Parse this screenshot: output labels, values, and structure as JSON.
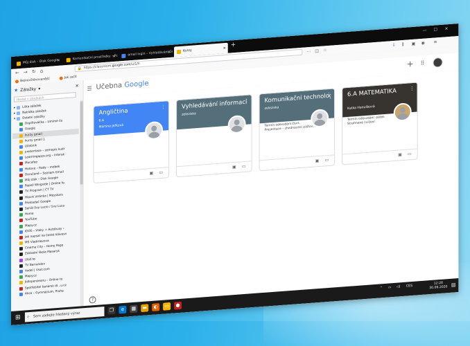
{
  "tabs": [
    {
      "label": "Můj disk – Disk Google",
      "color": "#f4b400",
      "active": false
    },
    {
      "label": "Komunikační prostředky – Po...",
      "color": "#f4b400",
      "active": false
    },
    {
      "label": "email login – Vyhledávání Goo...",
      "color": "#4285f4",
      "active": false
    },
    {
      "label": "Kurzy",
      "color": "#f4b400",
      "active": true
    }
  ],
  "nav": {
    "url_prefix": "https://classroom.",
    "url_domain": "google.com",
    "url_path": "/u/1/h"
  },
  "bookmarks_bar": [
    {
      "label": "Nejnavštěvovanější",
      "color": "#e8710a"
    },
    {
      "label": "Jak začít",
      "color": "#e8710a"
    }
  ],
  "sidebar": {
    "title": "Záložky",
    "search_placeholder": "Hledat v záložkách",
    "items": [
      {
        "label": "Lišta záložek",
        "level": "l1",
        "color": "#8ab4f8"
      },
      {
        "label": "Nabídka záložek",
        "level": "l1",
        "color": "#8ab4f8"
      },
      {
        "label": "Ostatní záložky",
        "level": "l1",
        "color": "#8ab4f8"
      },
      {
        "label": "Doplňováčka – Umíme če",
        "level": "l2",
        "color": "#34a853"
      },
      {
        "label": "Google",
        "level": "l2",
        "color": "#4285f4"
      },
      {
        "label": "kurzy gmail",
        "level": "l2",
        "color": "#f4b400",
        "selected": true
      },
      {
        "label": "kurzy gmail 1",
        "level": "l2",
        "color": "#f4b400"
      },
      {
        "label": "Učebnik",
        "level": "l2",
        "color": "#4285f4"
      },
      {
        "label": "prezentace – zemepis kudr",
        "level": "l2",
        "color": "#f4b400"
      },
      {
        "label": "Learningapps.org – interak",
        "level": "l2",
        "color": "#4285f4"
      },
      {
        "label": "Mocafee",
        "level": "l2",
        "color": "#c5221f"
      },
      {
        "label": "Hotove – Rady – mdbek",
        "level": "l2",
        "color": "#4285f4"
      },
      {
        "label": "Doručené – Seznam Email",
        "level": "l2",
        "color": "#c5221f"
      },
      {
        "label": "Můj disk – Disk Google",
        "level": "l2",
        "color": "#34a853"
      },
      {
        "label": "Papež Wingside | Online fo",
        "level": "l2",
        "color": "#4285f4"
      },
      {
        "label": "TV Program | ČT TV",
        "level": "l2",
        "color": "#202124"
      },
      {
        "label": "Hlavní stránka | Messkars",
        "level": "l2",
        "color": "#202124"
      },
      {
        "label": "Překladač Google",
        "level": "l2",
        "color": "#4285f4"
      },
      {
        "label": "Seriál Svy Lucio / Svy Luca",
        "level": "l2",
        "color": "#202124"
      },
      {
        "label": "Home",
        "level": "l2",
        "color": "#34a853"
      },
      {
        "label": "YouTube",
        "level": "l2",
        "color": "#c5221f"
      },
      {
        "label": "Mapy.cz",
        "level": "l2",
        "color": "#34a853"
      },
      {
        "label": "IDOS – Vlaky + Autobusy ›",
        "level": "l2",
        "color": "#4285f4"
      },
      {
        "label": "Jak napsat na české klávesn",
        "level": "l2",
        "color": "#c5221f"
      },
      {
        "label": "MŠ Vladislavova",
        "level": "l2",
        "color": "#f4b400"
      },
      {
        "label": "Cinema City – Home Page",
        "level": "l2",
        "color": "#202124"
      },
      {
        "label": "Základní škola Masaryk",
        "level": "l2",
        "color": "#202124"
      },
      {
        "label": "Ulož.to",
        "level": "l2",
        "color": "#a142f4"
      },
      {
        "label": "TV Barrandov",
        "level": "l2",
        "color": "#202124"
      },
      {
        "label": "Vodel | Vsat.com",
        "level": "l2",
        "color": "#4285f4"
      },
      {
        "label": "Mapy.cz",
        "level": "l2",
        "color": "#34a853"
      },
      {
        "label": "Jídlopenzeanu – Online to",
        "level": "l2",
        "color": "#f4b400"
      },
      {
        "label": "Spotřebitel banarsk dl...u.cz",
        "level": "l2",
        "color": "#c5221f"
      },
      {
        "label": "Akce – Gymnázium, Praha",
        "level": "l2",
        "color": "#4285f4"
      }
    ]
  },
  "classroom": {
    "title_word": "Učebna",
    "title_brand": "Google",
    "help": "?"
  },
  "courses": [
    {
      "name": "Angličtina",
      "section": "6.A",
      "teacher": "Martina Jeřková",
      "color": "#4285f4",
      "body1": "",
      "body2": "",
      "photo": false
    },
    {
      "name": "Vyhledávání informací",
      "section": "zeleziska",
      "teacher": "",
      "color": "#546e7a",
      "body1": "",
      "body2": "",
      "photo": false
    },
    {
      "name": "Komunikační technologie",
      "section": "zeleziska",
      "teacher": "",
      "color": "#546e7a",
      "body1": "Termín odevzdání čtvrt.",
      "body2": "Prezentace – zhodnocení zjišťov...",
      "photo": false
    },
    {
      "name": "6.A MATEMATIKA",
      "section": "",
      "teacher": "Katka Hanušková",
      "color": "#37332f",
      "body1": "Termín odevzdání: pátek",
      "body2": "Strafmené cvičení",
      "photo": true
    }
  ],
  "taskbar": {
    "search_text": "Sem zadejte hledaný výraz",
    "clock_time": "12:28",
    "clock_date": "30.06.2020",
    "tray_lang": "CES"
  }
}
